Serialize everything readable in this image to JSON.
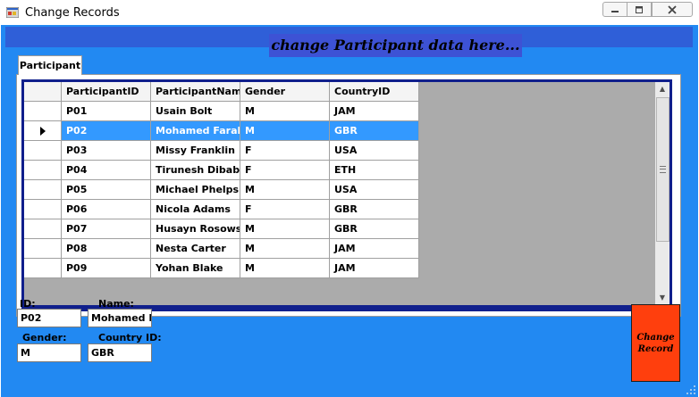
{
  "window": {
    "title": "Change Records"
  },
  "banner": {
    "text": "change Participant data here..."
  },
  "tab": {
    "label": "Participant"
  },
  "grid": {
    "columns": [
      "ParticipantID",
      "ParticipantName",
      "Gender",
      "CountryID"
    ],
    "selected_row": 1,
    "rows": [
      [
        "P01",
        "Usain Bolt",
        "M",
        "JAM"
      ],
      [
        "P02",
        "Mohamed Farah",
        "M",
        "GBR"
      ],
      [
        "P03",
        "Missy Franklin",
        "F",
        "USA"
      ],
      [
        "P04",
        "Tirunesh Dibaba",
        "F",
        "ETH"
      ],
      [
        "P05",
        "Michael Phelps",
        "M",
        "USA"
      ],
      [
        "P06",
        "Nicola Adams",
        "F",
        "GBR"
      ],
      [
        "P07",
        "Husayn Rosowsky",
        "M",
        "GBR"
      ],
      [
        "P08",
        "Nesta Carter",
        "M",
        "JAM"
      ],
      [
        "P09",
        "Yohan Blake",
        "M",
        "JAM"
      ]
    ]
  },
  "form": {
    "id_label": "ID:",
    "id_value": "P02",
    "name_label": "Name:",
    "name_value": "Mohamed Fa",
    "gender_label": "Gender:",
    "gender_value": "M",
    "country_label": "Country ID:",
    "country_value": "GBR"
  },
  "change_button": {
    "label": "Change Record"
  },
  "colors": {
    "client_bg": "#2289f2",
    "banner_bg": "#3d52d5",
    "grid_border": "#101f8c",
    "selection": "#3399ff",
    "button_bg": "#ff3f0d"
  },
  "icons": {
    "app": "form-app-icon",
    "minimize": "minimize-icon",
    "maximize": "maximize-icon",
    "close": "close-icon",
    "row_pointer": "row-pointer-icon",
    "scroll_up": "scroll-up-arrow-icon",
    "scroll_down": "scroll-down-arrow-icon",
    "resize": "resize-grip-icon"
  }
}
